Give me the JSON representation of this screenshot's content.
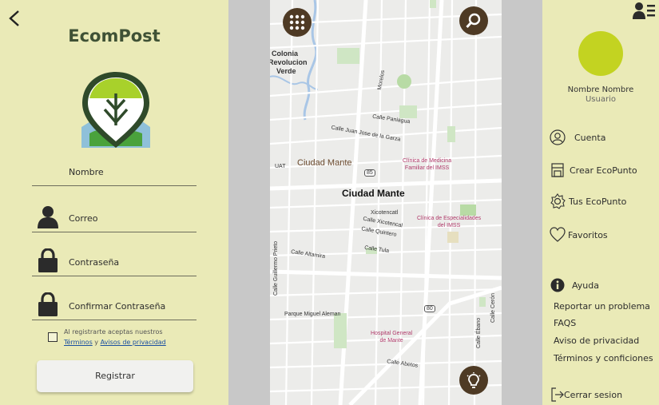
{
  "left": {
    "brand": "EcomPost",
    "fields": {
      "name": "Nombre",
      "email": "Correo",
      "password": "Contraseña",
      "confirm": "Confirmar Contraseña"
    },
    "terms": {
      "line1": "Al registrarte aceptas nuestros",
      "terms_link": "Términos",
      "and": " y ",
      "privacy_link": "Avisos de privacidad"
    },
    "register_button": "Registrar"
  },
  "map": {
    "labels": {
      "colonia1": "Colonia",
      "colonia2": "Revolucion",
      "colonia3": "Verde",
      "morelos": "Morelos",
      "paniagua": "Calle Paniagua",
      "juanjose": "Calle Juan Jose de la Garza",
      "uat": "UAT",
      "ciudad_mante_small": "Ciudad Mante",
      "clinica1a": "Clínica de Medicina",
      "clinica1b": "Familiar del IMSS",
      "route85": "85",
      "ciudad_mante": "Ciudad Mante",
      "xicotencatl": "Xicotencatl",
      "calle_xicotencal": "Calle Xicotencal",
      "calle_quintero": "Calle Quintero",
      "clinica2a": "Clínica de Especialidades",
      "clinica2b": "del IMSS",
      "calle_tula": "Calle Tula",
      "calle_altamira": "Calle Altamira",
      "guillermo": "Calle Guillermo Prieto",
      "parque": "Parque Miguel Aleman",
      "route80": "80",
      "hospital1": "Hospital General",
      "hospital2": "de Mante",
      "ebano": "Calle Ébano",
      "ceron": "Calle Cerón",
      "abetos": "Calle Abetos"
    }
  },
  "right": {
    "user_name": "Nombre Nombre",
    "user_role": "Usuario",
    "menu": {
      "account": "Cuenta",
      "create": "Crear EcoPunto",
      "mine": "Tus EcoPunto",
      "favorites": "Favoritos",
      "help": "Ayuda"
    },
    "links": {
      "report": "Reportar un problema",
      "faqs": "FAQS",
      "privacy": "Aviso de privacidad",
      "terms": "Términos y conficiones"
    },
    "logout": "Cerrar sesion"
  },
  "colors": {
    "panel_bg": "#eaeab7",
    "brand_green": "#3f5135",
    "lime": "#c3d321",
    "map_button": "#4e3a24"
  }
}
